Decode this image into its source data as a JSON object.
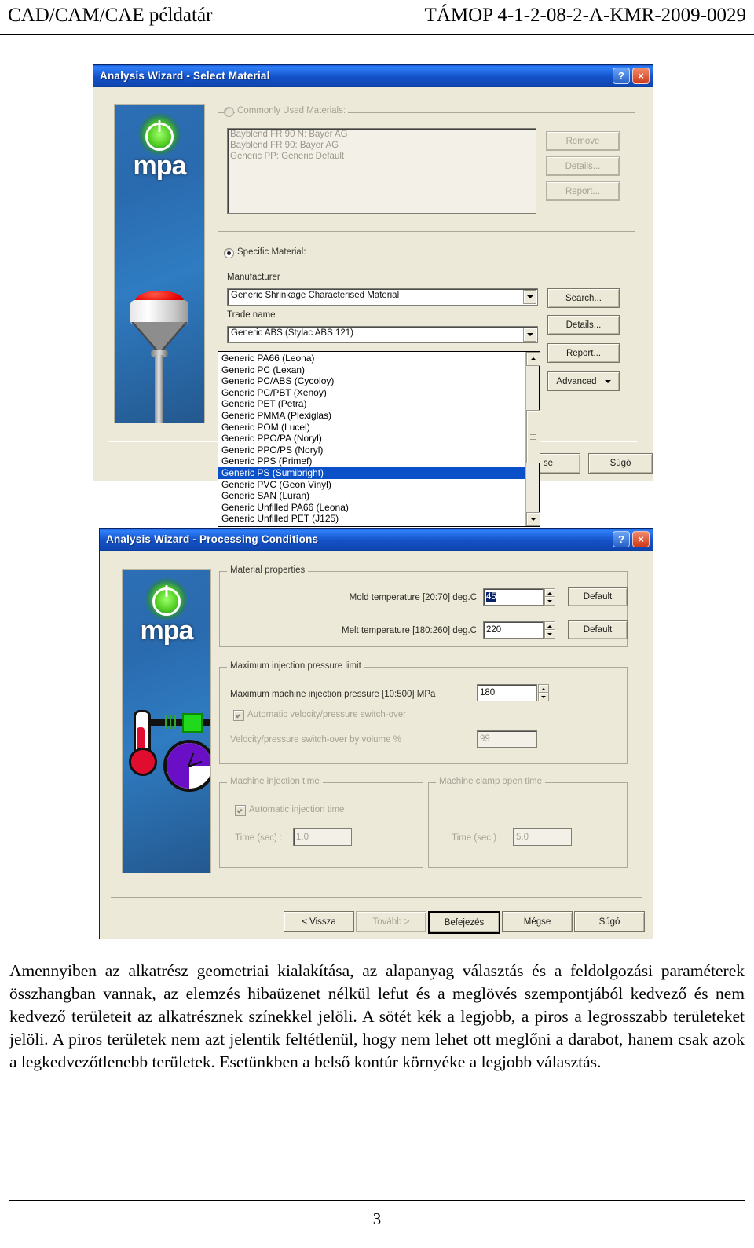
{
  "header": {
    "left": "CAD/CAM/CAE példatár",
    "right": "TÁMOP 4-1-2-08-2-A-KMR-2009-0029"
  },
  "dialog1": {
    "title": "Analysis Wizard - Select Material",
    "help_btn": "?",
    "close_btn": "×",
    "banner_logo_text": "mpa",
    "commonly_used": {
      "radio_label": "Commonly Used Materials:",
      "selected": false,
      "items": [
        "Bayblend FR 90 N: Bayer AG",
        "Bayblend FR 90: Bayer AG",
        "Generic PP: Generic Default"
      ],
      "buttons": [
        "Remove",
        "Details...",
        "Report..."
      ]
    },
    "specific_material": {
      "radio_label": "Specific Material:",
      "selected": true,
      "manufacturer_label": "Manufacturer",
      "manufacturer_value": "Generic Shrinkage Characterised Material",
      "trade_name_label": "Trade name",
      "trade_name_value": "Generic ABS (Stylac ABS 121)",
      "buttons": [
        "Search...",
        "Details...",
        "Report...",
        "Advanced"
      ]
    },
    "dropdown": {
      "open": true,
      "selected_index": 10,
      "options": [
        "Generic PA66 (Leona)",
        "Generic PC (Lexan)",
        "Generic PC/ABS (Cycoloy)",
        "Generic PC/PBT (Xenoy)",
        "Generic PET (Petra)",
        "Generic PMMA (Plexiglas)",
        "Generic POM (Lucel)",
        "Generic PPO/PA (Noryl)",
        "Generic PPO/PS (Noryl)",
        "Generic PPS (Primef)",
        "Generic PS (Sumibright)",
        "Generic PVC (Geon Vinyl)",
        "Generic SAN (Luran)",
        "Generic Unfilled PA66 (Leona)",
        "Generic Unfilled PET (J125)"
      ]
    },
    "footer_buttons": [
      "se",
      "Súgó"
    ]
  },
  "dialog2": {
    "title": "Analysis Wizard - Processing Conditions",
    "help_btn": "?",
    "close_btn": "×",
    "banner_logo_text": "mpa",
    "material_properties": {
      "group_title": "Material properties",
      "mold_temp_label": "Mold temperature [20:70] deg.C",
      "mold_temp_value": "45",
      "mold_temp_default": "Default",
      "melt_temp_label": "Melt temperature [180:260] deg.C",
      "melt_temp_value": "220",
      "melt_temp_default": "Default"
    },
    "pressure_limit": {
      "group_title": "Maximum injection pressure limit",
      "max_pressure_label": "Maximum machine injection pressure [10:500] MPa",
      "max_pressure_value": "180",
      "auto_switchover_label": "Automatic velocity/pressure switch-over",
      "auto_switchover_checked": true,
      "switchover_volume_label": "Velocity/pressure switch-over by volume %",
      "switchover_volume_value": "99"
    },
    "injection_time": {
      "group_title": "Machine injection time",
      "auto_label": "Automatic injection time",
      "auto_checked": true,
      "time_label": "Time (sec) :",
      "time_value": "1.0"
    },
    "clamp_open_time": {
      "group_title": "Machine clamp open time",
      "time_label": "Time (sec ) :",
      "time_value": "5.0"
    },
    "footer_buttons": [
      {
        "label": "< Vissza",
        "state": "enabled"
      },
      {
        "label": "Tovább >",
        "state": "disabled"
      },
      {
        "label": "Befejezés",
        "state": "default"
      },
      {
        "label": "Mégse",
        "state": "enabled"
      },
      {
        "label": "Súgó",
        "state": "enabled"
      }
    ]
  },
  "body_text": "Amennyiben az alkatrész geometriai kialakítása, az alapanyag választás és a feldolgozási paraméterek összhangban vannak, az elemzés hibaüzenet nélkül lefut és a meglövés szempontjából kedvező és nem kedvező területeit az alkatrésznek színekkel jelöli. A sötét kék a legjobb, a piros a legrosszabb területeket jelöli. A piros területek nem azt jelentik feltétlenül, hogy nem lehet ott meglőni a darabot, hanem csak azok a legkedvezőtlenebb területek. Esetünkben a belső kontúr környéke a legjobb választás.",
  "page_number": "3",
  "colors": {
    "titlebar": "#1552c8",
    "dialog_face": "#ece9d8",
    "selection": "#0a50c8",
    "accent_green": "#22d81c",
    "accent_red": "#e10d2e"
  }
}
